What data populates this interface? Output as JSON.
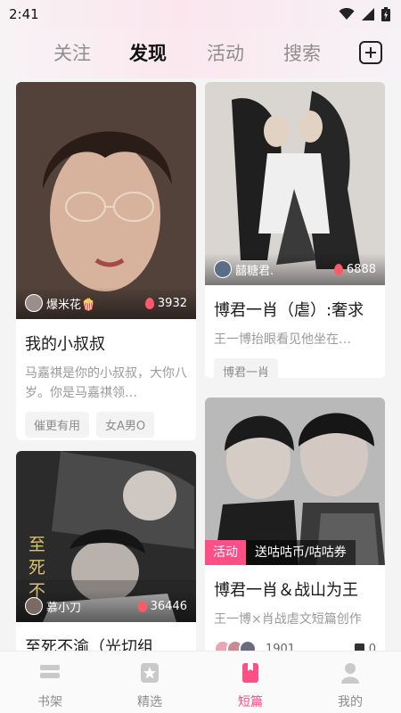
{
  "status": {
    "time": "2:41"
  },
  "tabs": [
    {
      "label": "关注"
    },
    {
      "label": "发现",
      "active": true
    },
    {
      "label": "活动"
    },
    {
      "label": "搜索"
    }
  ],
  "cards": [
    {
      "author": "爆米花🍿",
      "heat": "3932",
      "title": "我的小叔叔",
      "desc": "马嘉祺是你的小叔叔，大你八岁。你是马嘉祺领…",
      "tags": [
        "催更有用",
        "女A男O"
      ]
    },
    {
      "author": "囍糖君.",
      "heat": "6888",
      "title": "博君一肖（虐）:奢求",
      "desc": "王一博抬眼看见他坐在…",
      "tags": [
        "博君一肖"
      ]
    },
    {
      "author": "慕小刀",
      "heat": "36446",
      "title": "至死不渝（光切组",
      "cover_text": "至 死 不"
    },
    {
      "promo_tag": "活动",
      "promo_text": "送咕咕币/咕咕券",
      "title": "博君一肖＆战山为王",
      "desc": "王一博×肖战虐文短篇创作",
      "stat_people": "1901",
      "stat_books": "0"
    }
  ],
  "bottom_nav": [
    {
      "label": "书架",
      "icon": "bookshelf-icon"
    },
    {
      "label": "精选",
      "icon": "featured-icon"
    },
    {
      "label": "短篇",
      "icon": "short-story-icon",
      "active": true
    },
    {
      "label": "我的",
      "icon": "profile-icon"
    }
  ],
  "colors": {
    "accent": "#ff4f86",
    "heat": "#ff5a6a",
    "inactive_text": "#8c8c8c"
  }
}
